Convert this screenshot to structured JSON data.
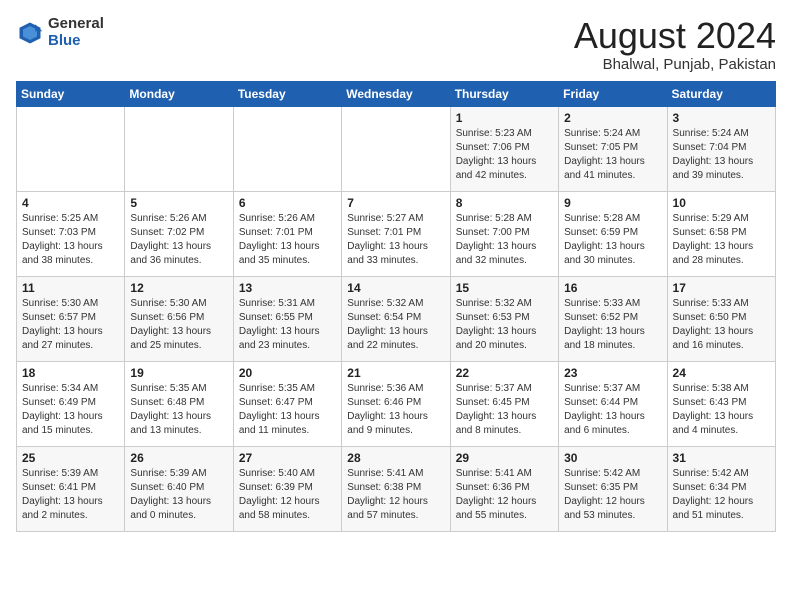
{
  "header": {
    "logo_general": "General",
    "logo_blue": "Blue",
    "month_year": "August 2024",
    "location": "Bhalwal, Punjab, Pakistan"
  },
  "days_of_week": [
    "Sunday",
    "Monday",
    "Tuesday",
    "Wednesday",
    "Thursday",
    "Friday",
    "Saturday"
  ],
  "weeks": [
    [
      {
        "day": "",
        "detail": ""
      },
      {
        "day": "",
        "detail": ""
      },
      {
        "day": "",
        "detail": ""
      },
      {
        "day": "",
        "detail": ""
      },
      {
        "day": "1",
        "detail": "Sunrise: 5:23 AM\nSunset: 7:06 PM\nDaylight: 13 hours\nand 42 minutes."
      },
      {
        "day": "2",
        "detail": "Sunrise: 5:24 AM\nSunset: 7:05 PM\nDaylight: 13 hours\nand 41 minutes."
      },
      {
        "day": "3",
        "detail": "Sunrise: 5:24 AM\nSunset: 7:04 PM\nDaylight: 13 hours\nand 39 minutes."
      }
    ],
    [
      {
        "day": "4",
        "detail": "Sunrise: 5:25 AM\nSunset: 7:03 PM\nDaylight: 13 hours\nand 38 minutes."
      },
      {
        "day": "5",
        "detail": "Sunrise: 5:26 AM\nSunset: 7:02 PM\nDaylight: 13 hours\nand 36 minutes."
      },
      {
        "day": "6",
        "detail": "Sunrise: 5:26 AM\nSunset: 7:01 PM\nDaylight: 13 hours\nand 35 minutes."
      },
      {
        "day": "7",
        "detail": "Sunrise: 5:27 AM\nSunset: 7:01 PM\nDaylight: 13 hours\nand 33 minutes."
      },
      {
        "day": "8",
        "detail": "Sunrise: 5:28 AM\nSunset: 7:00 PM\nDaylight: 13 hours\nand 32 minutes."
      },
      {
        "day": "9",
        "detail": "Sunrise: 5:28 AM\nSunset: 6:59 PM\nDaylight: 13 hours\nand 30 minutes."
      },
      {
        "day": "10",
        "detail": "Sunrise: 5:29 AM\nSunset: 6:58 PM\nDaylight: 13 hours\nand 28 minutes."
      }
    ],
    [
      {
        "day": "11",
        "detail": "Sunrise: 5:30 AM\nSunset: 6:57 PM\nDaylight: 13 hours\nand 27 minutes."
      },
      {
        "day": "12",
        "detail": "Sunrise: 5:30 AM\nSunset: 6:56 PM\nDaylight: 13 hours\nand 25 minutes."
      },
      {
        "day": "13",
        "detail": "Sunrise: 5:31 AM\nSunset: 6:55 PM\nDaylight: 13 hours\nand 23 minutes."
      },
      {
        "day": "14",
        "detail": "Sunrise: 5:32 AM\nSunset: 6:54 PM\nDaylight: 13 hours\nand 22 minutes."
      },
      {
        "day": "15",
        "detail": "Sunrise: 5:32 AM\nSunset: 6:53 PM\nDaylight: 13 hours\nand 20 minutes."
      },
      {
        "day": "16",
        "detail": "Sunrise: 5:33 AM\nSunset: 6:52 PM\nDaylight: 13 hours\nand 18 minutes."
      },
      {
        "day": "17",
        "detail": "Sunrise: 5:33 AM\nSunset: 6:50 PM\nDaylight: 13 hours\nand 16 minutes."
      }
    ],
    [
      {
        "day": "18",
        "detail": "Sunrise: 5:34 AM\nSunset: 6:49 PM\nDaylight: 13 hours\nand 15 minutes."
      },
      {
        "day": "19",
        "detail": "Sunrise: 5:35 AM\nSunset: 6:48 PM\nDaylight: 13 hours\nand 13 minutes."
      },
      {
        "day": "20",
        "detail": "Sunrise: 5:35 AM\nSunset: 6:47 PM\nDaylight: 13 hours\nand 11 minutes."
      },
      {
        "day": "21",
        "detail": "Sunrise: 5:36 AM\nSunset: 6:46 PM\nDaylight: 13 hours\nand 9 minutes."
      },
      {
        "day": "22",
        "detail": "Sunrise: 5:37 AM\nSunset: 6:45 PM\nDaylight: 13 hours\nand 8 minutes."
      },
      {
        "day": "23",
        "detail": "Sunrise: 5:37 AM\nSunset: 6:44 PM\nDaylight: 13 hours\nand 6 minutes."
      },
      {
        "day": "24",
        "detail": "Sunrise: 5:38 AM\nSunset: 6:43 PM\nDaylight: 13 hours\nand 4 minutes."
      }
    ],
    [
      {
        "day": "25",
        "detail": "Sunrise: 5:39 AM\nSunset: 6:41 PM\nDaylight: 13 hours\nand 2 minutes."
      },
      {
        "day": "26",
        "detail": "Sunrise: 5:39 AM\nSunset: 6:40 PM\nDaylight: 13 hours\nand 0 minutes."
      },
      {
        "day": "27",
        "detail": "Sunrise: 5:40 AM\nSunset: 6:39 PM\nDaylight: 12 hours\nand 58 minutes."
      },
      {
        "day": "28",
        "detail": "Sunrise: 5:41 AM\nSunset: 6:38 PM\nDaylight: 12 hours\nand 57 minutes."
      },
      {
        "day": "29",
        "detail": "Sunrise: 5:41 AM\nSunset: 6:36 PM\nDaylight: 12 hours\nand 55 minutes."
      },
      {
        "day": "30",
        "detail": "Sunrise: 5:42 AM\nSunset: 6:35 PM\nDaylight: 12 hours\nand 53 minutes."
      },
      {
        "day": "31",
        "detail": "Sunrise: 5:42 AM\nSunset: 6:34 PM\nDaylight: 12 hours\nand 51 minutes."
      }
    ]
  ]
}
